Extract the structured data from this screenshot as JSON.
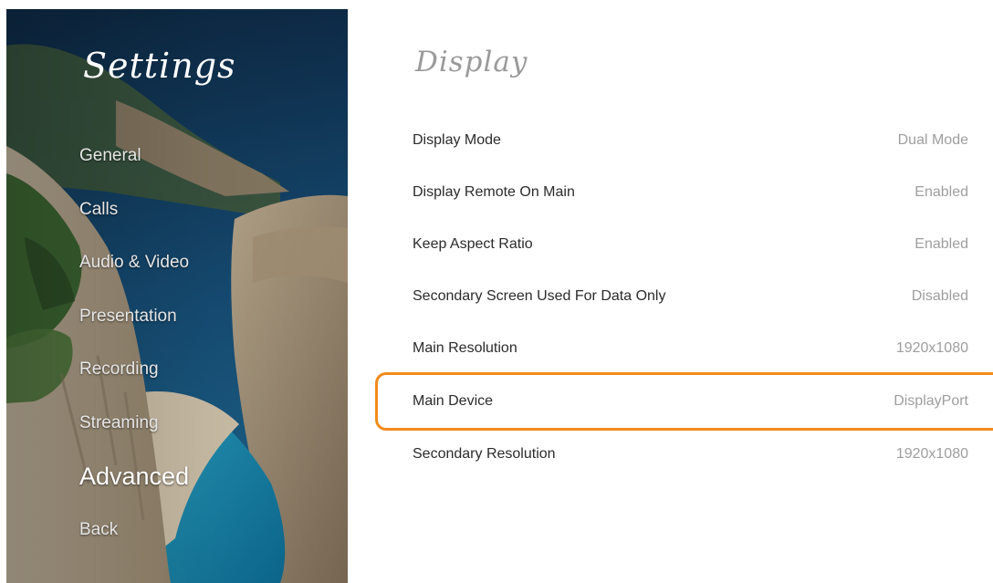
{
  "sidebar": {
    "title": "Settings",
    "items": [
      {
        "label": "General",
        "active": false
      },
      {
        "label": "Calls",
        "active": false
      },
      {
        "label": "Audio & Video",
        "active": false
      },
      {
        "label": "Presentation",
        "active": false
      },
      {
        "label": "Recording",
        "active": false
      },
      {
        "label": "Streaming",
        "active": false
      },
      {
        "label": "Advanced",
        "active": true
      },
      {
        "label": "Back",
        "active": false
      }
    ]
  },
  "main": {
    "title": "Display",
    "rows": [
      {
        "label": "Display Mode",
        "value": "Dual Mode"
      },
      {
        "label": "Display Remote On Main",
        "value": "Enabled"
      },
      {
        "label": "Keep Aspect Ratio",
        "value": "Enabled"
      },
      {
        "label": "Secondary Screen Used For Data Only",
        "value": "Disabled"
      },
      {
        "label": "Main Resolution",
        "value": "1920x1080"
      },
      {
        "label": "Main Device",
        "value": "DisplayPort",
        "focused": true
      },
      {
        "label": "Secondary Resolution",
        "value": "1920x1080"
      }
    ]
  },
  "colors": {
    "focus_outline": "#f28a1a",
    "label_text": "#2b2b2b",
    "value_text": "#9e9e9e",
    "section_title": "#9a9a9a"
  }
}
